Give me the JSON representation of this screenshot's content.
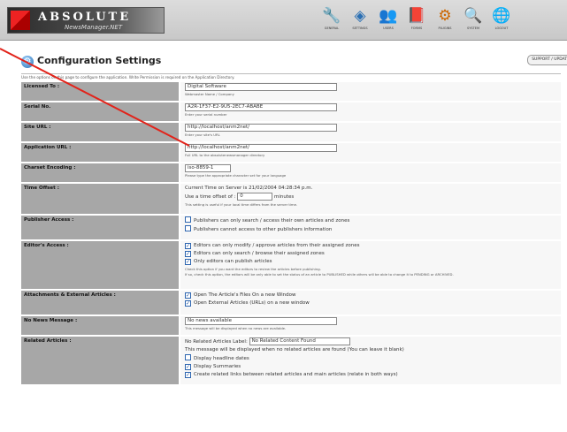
{
  "header": {
    "logo_text": "ABSOLUTE",
    "logo_sub": "NewsManager.NET",
    "nav": [
      {
        "label": "GENERAL",
        "icon": "wrench-icon"
      },
      {
        "label": "SETTINGS",
        "icon": "diamond-icon"
      },
      {
        "label": "USERS",
        "icon": "users-icon"
      },
      {
        "label": "FORMS",
        "icon": "document-icon"
      },
      {
        "label": "PLUGINS",
        "icon": "plugin-icon"
      },
      {
        "label": "SYSTEM",
        "icon": "magnifier-icon"
      },
      {
        "label": "LOGOUT",
        "icon": "globe-icon"
      }
    ]
  },
  "page": {
    "title": "Configuration Settings",
    "support_label": "SUPPORT / UPDATES",
    "hint": "Use the options on this page to configure the application. Write Permission is required on the Application Directory."
  },
  "fields": {
    "licensed_to": {
      "label": "Licensed To :",
      "value": "Digital Software",
      "note": "Webmaster Name / Company"
    },
    "serial_no": {
      "label": "Serial No.",
      "value": "A2R-1F37-E2-9U5-2EC7-ABABE",
      "note": "Enter your serial number"
    },
    "site_url": {
      "label": "Site URL :",
      "value": "http://localhost/anm2net/",
      "note": "Enter your site's URL"
    },
    "application_url": {
      "label": "Application URL :",
      "value": "http://localhost/anm2net/",
      "note": "Full URL to the absolutenewsmanager directory"
    },
    "charset": {
      "label": "Charset Encoding :",
      "value": "iso-8859-1",
      "note": "Please type the appropriate character set for your language"
    },
    "time_offset": {
      "label": "Time Offset :",
      "current_time": "Current Time on Server is 21/02/2004 04:28:34 p.m.",
      "prefix": "Use a time offset of :",
      "value": "0",
      "suffix": "minutes",
      "note": "This setting is useful if your local time differs from the server time."
    },
    "publishers_access": {
      "label": "Publisher Access :",
      "options": [
        {
          "checked": false,
          "text": "Publishers can only search / access their own articles and zones"
        },
        {
          "checked": false,
          "text": "Publishers cannot access to other publishers information"
        }
      ]
    },
    "editors_access": {
      "label": "Editor's Access :",
      "options": [
        {
          "checked": true,
          "text": "Editors can only modify / approve articles from their assigned zones"
        },
        {
          "checked": true,
          "text": "Editors can only search / browse their assigned zones"
        },
        {
          "checked": true,
          "text": "Only editors can publish articles"
        }
      ],
      "note1": "Check this option if you want the editors to review the articles before publishing.",
      "note2": "If so, check this option, the editors will be only able to set the status of an article to PUBLISHED while others will be able to change it to PENDING or ARCHIVED."
    },
    "attachments": {
      "label": "Attachments & External Articles :",
      "options": [
        {
          "checked": true,
          "text": "Open The Article's Files On a new Window"
        },
        {
          "checked": true,
          "text": "Open External Articles (URLs) on a new window"
        }
      ]
    },
    "no_news": {
      "label": "No News Message :",
      "value": "No news available",
      "note": "This message will be displayed when no news are available."
    },
    "related": {
      "label": "Related Articles :",
      "field_label": "No Related Articles Label:",
      "value": "No Related Content Found",
      "message": "This message will be displayed when no related articles are found (You can leave it blank)",
      "options": [
        {
          "checked": false,
          "text": "Display headline dates"
        },
        {
          "checked": true,
          "text": "Display Summaries"
        },
        {
          "checked": true,
          "text": "Create related links between related articles and main articles (relate in both ways)"
        }
      ]
    }
  }
}
